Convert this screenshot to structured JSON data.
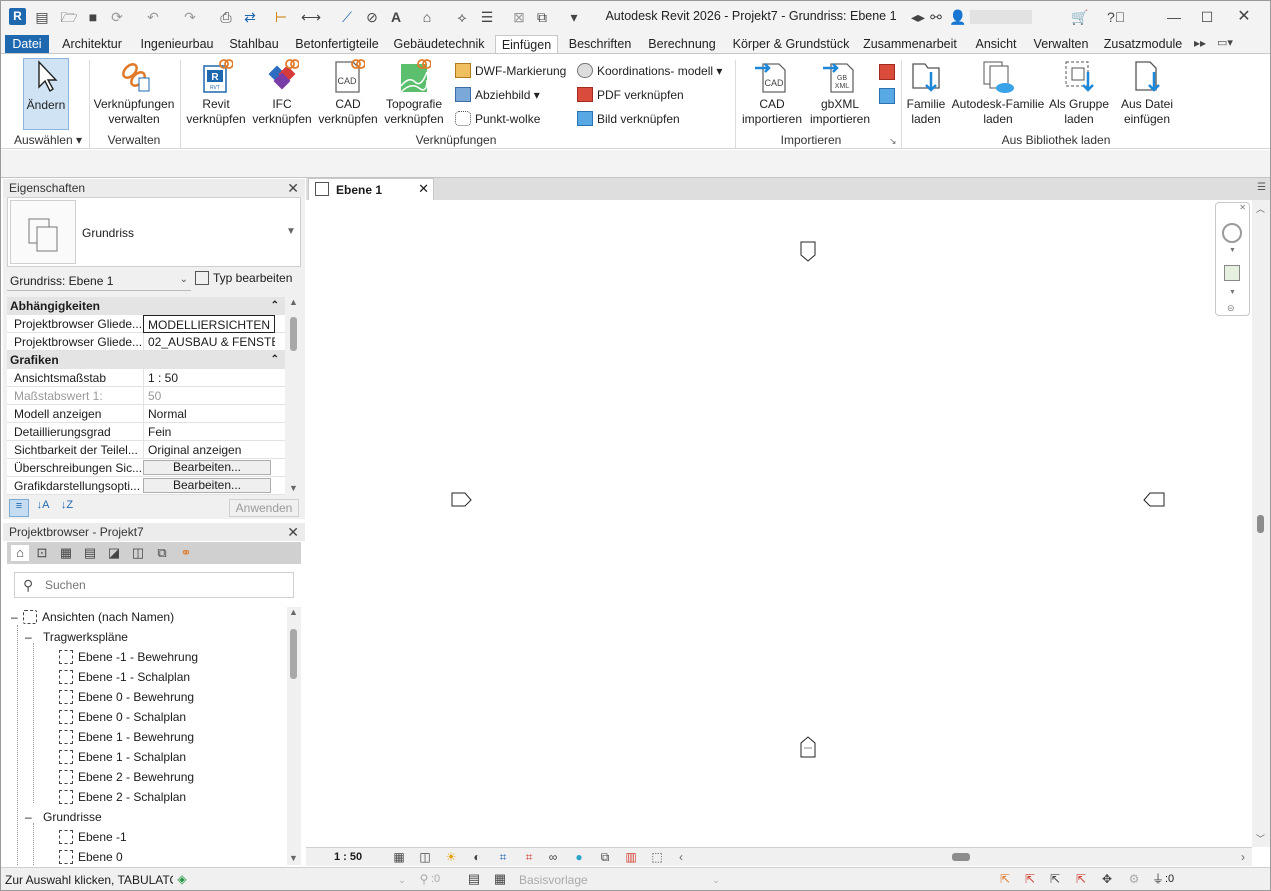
{
  "window": {
    "title": "Autodesk Revit 2026 - Projekt7 - Grundriss: Ebene 1",
    "app_badge": "R"
  },
  "qat": {
    "icons": [
      "home-revit-icon",
      "open-icon",
      "save-icon",
      "sync-icon",
      "undo-icon",
      "redo-icon",
      "print-icon",
      "transfer-icon",
      "measure-icon",
      "dimension-icon",
      "tag-icon",
      "text-icon",
      "default-3d-icon",
      "section-icon",
      "thin-lines-icon",
      "close-windows-icon",
      "switch-windows-icon",
      "customize-icon"
    ]
  },
  "tabs": [
    {
      "label": "Datei"
    },
    {
      "label": "Architektur"
    },
    {
      "label": "Ingenieurbau"
    },
    {
      "label": "Stahlbau"
    },
    {
      "label": "Betonfertigteile"
    },
    {
      "label": "Gebäudetechnik"
    },
    {
      "label": "Einfügen"
    },
    {
      "label": "Beschriften"
    },
    {
      "label": "Berechnung"
    },
    {
      "label": "Körper & Grundstück"
    },
    {
      "label": "Zusammenarbeit"
    },
    {
      "label": "Ansicht"
    },
    {
      "label": "Verwalten"
    },
    {
      "label": "Zusatzmodule"
    }
  ],
  "ribbon": {
    "select": {
      "modify": "Ändern",
      "group": "Auswählen"
    },
    "manage": {
      "links_line1": "Verknüpfungen",
      "links_line2": "verwalten",
      "group": "Verwalten"
    },
    "links": {
      "revit_1": "Revit",
      "revit_2": "verknüpfen",
      "ifc_1": "IFC",
      "ifc_2": "verknüpfen",
      "cad_1": "CAD",
      "cad_2": "verknüpfen",
      "topo_1": "Topografie",
      "topo_2": "verknüpfen",
      "dwf": "DWF-Markierung",
      "decal": "Abziehbild",
      "pointcloud": "Punkt-wolke",
      "coord": "Koordinations- modell",
      "pdf": "PDF  verknüpfen",
      "image": "Bild  verknüpfen",
      "group": "Verknüpfungen"
    },
    "import": {
      "cad_1": "CAD",
      "cad_2": "importieren",
      "gbxml_1": "gbXML",
      "gbxml_2": "importieren",
      "group": "Importieren"
    },
    "library": {
      "family_1": "Familie",
      "family_2": "laden",
      "adsk_1": "Autodesk-Familie",
      "adsk_2": "laden",
      "group_1": "Als Gruppe",
      "group_2": "laden",
      "file_1": "Aus Datei",
      "file_2": "einfügen",
      "group": "Aus Bibliothek laden"
    }
  },
  "properties": {
    "title": "Eigenschaften",
    "type_name": "Grundriss",
    "instance": "Grundriss: Ebene 1",
    "edit_type": "Typ bearbeiten",
    "sections": [
      {
        "name": "Abhängigkeiten"
      },
      {
        "name": "Grafiken"
      }
    ],
    "rows": [
      {
        "name": "Projektbrowser Gliede...",
        "value": "MODELLIERSICHTEN"
      },
      {
        "name": "Projektbrowser Gliede...",
        "value": "02_AUSBAU & FENSTE..."
      },
      {
        "name": "Ansichtsmaßstab",
        "value": "1 : 50"
      },
      {
        "name": "Maßstabswert    1:",
        "value": "50"
      },
      {
        "name": "Modell anzeigen",
        "value": "Normal"
      },
      {
        "name": "Detaillierungsgrad",
        "value": "Fein"
      },
      {
        "name": "Sichtbarkeit der Teilel...",
        "value": "Original anzeigen"
      },
      {
        "name": "Überschreibungen Sic...",
        "value": "Bearbeiten..."
      },
      {
        "name": "Grafikdarstellungsopti...",
        "value": "Bearbeiten..."
      }
    ],
    "apply": "Anwenden"
  },
  "browser": {
    "title": "Projektbrowser - Projekt7",
    "search_placeholder": "Suchen",
    "root": "Ansichten (nach Namen)",
    "groups": [
      {
        "name": "Tragwerkspläne",
        "items": [
          "Ebene -1 - Bewehrung",
          "Ebene -1 - Schalplan",
          "Ebene 0 - Bewehrung",
          "Ebene 0 - Schalplan",
          "Ebene 1 - Bewehrung",
          "Ebene 1 - Schalplan",
          "Ebene 2 - Bewehrung",
          "Ebene 2 - Schalplan"
        ]
      },
      {
        "name": "Grundrisse",
        "items": [
          "Ebene -1",
          "Ebene 0"
        ]
      }
    ]
  },
  "view": {
    "tab": "Ebene 1",
    "scale": "1 : 50"
  },
  "status": {
    "hint": "Zur Auswahl klicken, TABULATO",
    "workset_count": ":0",
    "template": "Basisvorlage",
    "filter_count": ":0"
  },
  "colors": {
    "accent": "#1e68b0",
    "link_orange": "#e07b2a"
  }
}
